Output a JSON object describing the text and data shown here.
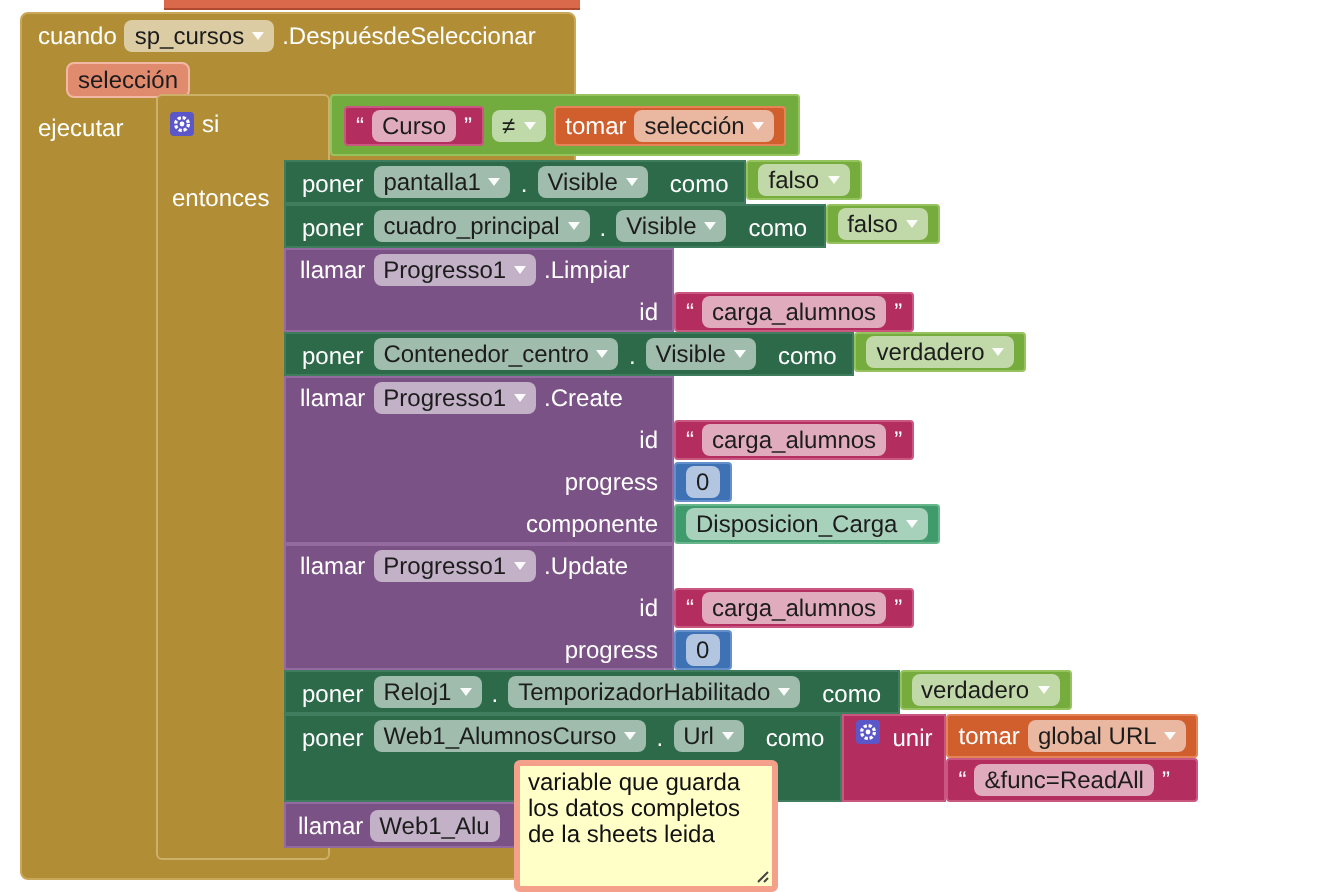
{
  "event": {
    "keyword": "cuando",
    "component": "sp_cursos",
    "event": ".DespuésdeSeleccionar",
    "parameter": "selección",
    "body_label": "ejecutar"
  },
  "if_block": {
    "keyword": "si",
    "then_label": "entonces",
    "condition": {
      "kind": "compare",
      "left": {
        "kind": "text",
        "open": "“",
        "value": "Curso",
        "close": "”"
      },
      "operator": "≠",
      "right": {
        "kind": "get",
        "keyword": "tomar",
        "variable": "selección"
      }
    }
  },
  "statements": [
    {
      "kind": "set",
      "keyword": "poner",
      "component": "pantalla1",
      "dot": ".",
      "property": "Visible",
      "to_label": "como",
      "value": {
        "kind": "boolean",
        "value": "falso"
      }
    },
    {
      "kind": "set",
      "keyword": "poner",
      "component": "cuadro_principal",
      "dot": ".",
      "property": "Visible",
      "to_label": "como",
      "value": {
        "kind": "boolean",
        "value": "falso"
      }
    },
    {
      "kind": "call",
      "keyword": "llamar",
      "component": "Progresso1",
      "method": ".Limpiar",
      "args": [
        {
          "label": "id",
          "value": {
            "kind": "text",
            "open": "“",
            "value": "carga_alumnos",
            "close": "”"
          }
        }
      ]
    },
    {
      "kind": "set",
      "keyword": "poner",
      "component": "Contenedor_centro",
      "dot": ".",
      "property": "Visible",
      "to_label": "como",
      "value": {
        "kind": "boolean",
        "value": "verdadero"
      }
    },
    {
      "kind": "call",
      "keyword": "llamar",
      "component": "Progresso1",
      "method": ".Create",
      "args": [
        {
          "label": "id",
          "value": {
            "kind": "text",
            "open": "“",
            "value": "carga_alumnos",
            "close": "”"
          }
        },
        {
          "label": "progress",
          "value": {
            "kind": "number",
            "value": "0"
          }
        },
        {
          "label": "componente",
          "value": {
            "kind": "component",
            "value": "Disposicion_Carga"
          }
        }
      ]
    },
    {
      "kind": "call",
      "keyword": "llamar",
      "component": "Progresso1",
      "method": ".Update",
      "args": [
        {
          "label": "id",
          "value": {
            "kind": "text",
            "open": "“",
            "value": "carga_alumnos",
            "close": "”"
          }
        },
        {
          "label": "progress",
          "value": {
            "kind": "number",
            "value": "0"
          }
        }
      ]
    },
    {
      "kind": "set",
      "keyword": "poner",
      "component": "Reloj1",
      "dot": ".",
      "property": "TemporizadorHabilitado",
      "to_label": "como",
      "value": {
        "kind": "boolean",
        "value": "verdadero"
      }
    },
    {
      "kind": "set",
      "keyword": "poner",
      "component": "Web1_AlumnosCurso",
      "dot": ".",
      "property": "Url",
      "to_label": "como",
      "value": {
        "kind": "join",
        "keyword": "unir",
        "items": [
          {
            "kind": "get",
            "keyword": "tomar",
            "variable": "global URL"
          },
          {
            "kind": "text",
            "open": "“",
            "value": "&func=ReadAll",
            "close": "”"
          }
        ]
      }
    },
    {
      "kind": "call_cut",
      "keyword": "llamar",
      "component": "Web1_Alu"
    }
  ],
  "comment": {
    "lines": [
      "variable que guarda",
      "los datos completos",
      "de la sheets leida"
    ]
  }
}
